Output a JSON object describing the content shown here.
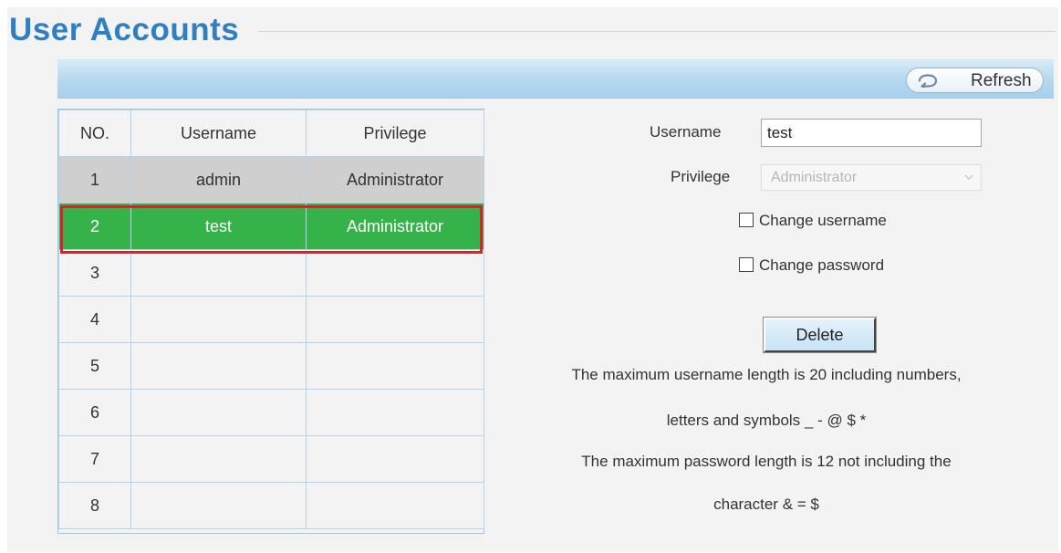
{
  "page": {
    "title": "User Accounts"
  },
  "toolbar": {
    "refresh_label": "Refresh"
  },
  "table": {
    "headers": [
      "NO.",
      "Username",
      "Privilege"
    ],
    "rows": [
      {
        "no": "1",
        "username": "admin",
        "privilege": "Administrator"
      },
      {
        "no": "2",
        "username": "test",
        "privilege": "Administrator"
      },
      {
        "no": "3",
        "username": "",
        "privilege": ""
      },
      {
        "no": "4",
        "username": "",
        "privilege": ""
      },
      {
        "no": "5",
        "username": "",
        "privilege": ""
      },
      {
        "no": "6",
        "username": "",
        "privilege": ""
      },
      {
        "no": "7",
        "username": "",
        "privilege": ""
      },
      {
        "no": "8",
        "username": "",
        "privilege": ""
      }
    ],
    "selected_row": "2"
  },
  "form": {
    "username_label": "Username",
    "username_value": "test",
    "privilege_label": "Privilege",
    "privilege_value": "Administrator",
    "change_username_label": "Change username",
    "change_password_label": "Change password",
    "delete_label": "Delete"
  },
  "notes": {
    "line1": "The maximum username length is 20 including numbers,",
    "line2": "letters and symbols _ - @ $ *",
    "line3": "The maximum password length is 12 not including the",
    "line4": "character & = $"
  },
  "colors": {
    "title": "#2f7fc2",
    "selected_row": "#35b34a",
    "selected_outline": "#d8222a",
    "admin_row": "#cfcfcf",
    "toolbar": "#b5d7ef"
  }
}
